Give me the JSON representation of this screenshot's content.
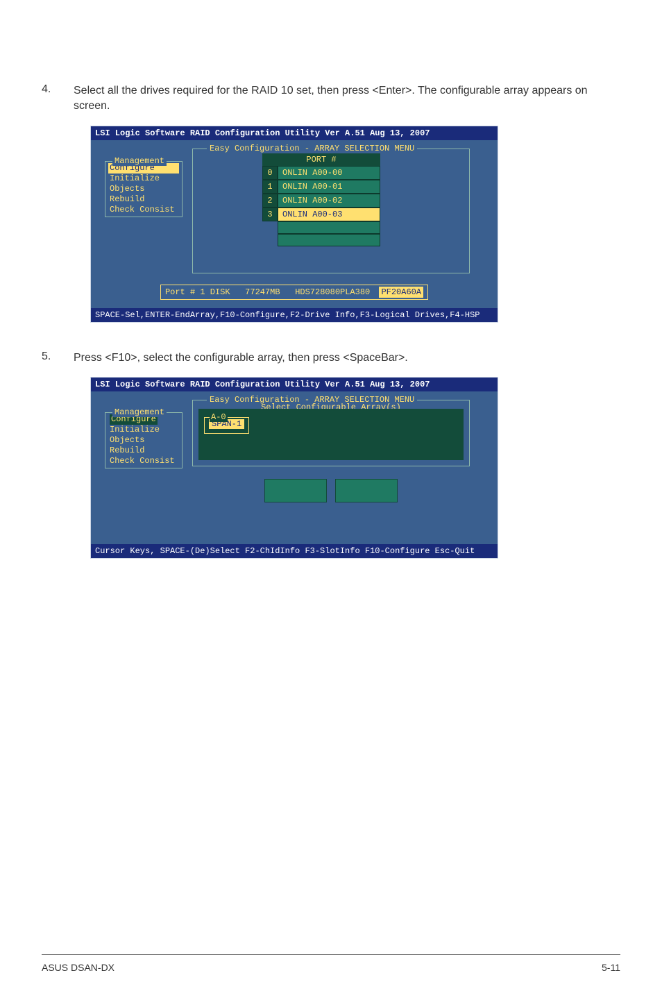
{
  "steps": {
    "s4": {
      "num": "4.",
      "text": "Select all the drives required for the RAID 10 set, then press <Enter>. The configurable array appears on screen."
    },
    "s5": {
      "num": "5.",
      "text": "Press <F10>, select the configurable array, then press <SpaceBar>."
    }
  },
  "bios1": {
    "header": "LSI Logic Software RAID Configuration Utility Ver A.51 Aug 13, 2007",
    "menu_legend": "Management",
    "menu": [
      "Configure",
      "Initialize",
      "Objects",
      "Rebuild",
      "Check Consist"
    ],
    "mid_legend": "Easy Configuration - ARRAY SELECTION MENU",
    "port_head": "PORT #",
    "rows": [
      {
        "idx": "0",
        "label": "ONLIN A00-00",
        "style": "teal"
      },
      {
        "idx": "1",
        "label": "ONLIN A00-01",
        "style": "teal"
      },
      {
        "idx": "2",
        "label": "ONLIN A00-02",
        "style": "teal"
      },
      {
        "idx": "3",
        "label": "ONLIN A00-03",
        "style": "yel"
      }
    ],
    "status": {
      "port": "Port # 1 DISK",
      "size": "77247MB",
      "model": "HDS728080PLA380",
      "id": "PF20A60A"
    },
    "footer": "SPACE-Sel,ENTER-EndArray,F10-Configure,F2-Drive Info,F3-Logical Drives,F4-HSP"
  },
  "bios2": {
    "header": "LSI Logic Software RAID Configuration Utility Ver A.51 Aug 13, 2007",
    "menu_legend": "Management",
    "menu": [
      "Configure",
      "Initialize",
      "Objects",
      "Rebuild",
      "Check Consist"
    ],
    "mid_legend": "Easy Configuration - ARRAY SELECTION MENU",
    "sub_legend": "Select Configurable Array(s)",
    "a0_legend": "A-0",
    "span": "SPAN-1",
    "footer": "Cursor Keys, SPACE-(De)Select F2-ChIdInfo F3-SlotInfo F10-Configure Esc-Quit"
  },
  "footer": {
    "left": "ASUS DSAN-DX",
    "right": "5-11"
  }
}
